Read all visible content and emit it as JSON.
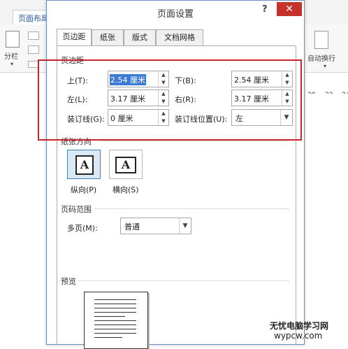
{
  "background_app": {
    "active_tab": "页面布局",
    "ribbon_left": [
      "分栏"
    ],
    "ribbon_right": "自动换行",
    "ruler_numbers": [
      "20",
      "22",
      "24"
    ]
  },
  "dialog": {
    "title": "页面设置",
    "help": "?",
    "close": "✕",
    "tabs": [
      "页边距",
      "纸张",
      "版式",
      "文档网格"
    ],
    "active_tab": 0,
    "margins": {
      "section": "页边距",
      "top_label": "上(T):",
      "top_value": "2.54 厘米",
      "bottom_label": "下(B):",
      "bottom_value": "2.54 厘米",
      "left_label": "左(L):",
      "left_value": "3.17 厘米",
      "right_label": "右(R):",
      "right_value": "3.17 厘米",
      "gutter_label": "装订线(G):",
      "gutter_value": "0 厘米",
      "gutter_pos_label": "装订线位置(U):",
      "gutter_pos_value": "左"
    },
    "orientation": {
      "section": "纸张方向",
      "portrait": "纵向(P)",
      "landscape": "横向(S)",
      "glyph": "A",
      "selected": "portrait"
    },
    "pages": {
      "section": "页码范围",
      "multi_label": "多页(M):",
      "multi_value": "普通"
    },
    "preview": {
      "section": "预览"
    }
  },
  "watermark": {
    "line1": "无忧电脑学习网",
    "line2": "wypcw.com"
  },
  "colors": {
    "highlight": "#c8242c",
    "close_button": "#c7312c",
    "selection": "#3a7bd5"
  }
}
